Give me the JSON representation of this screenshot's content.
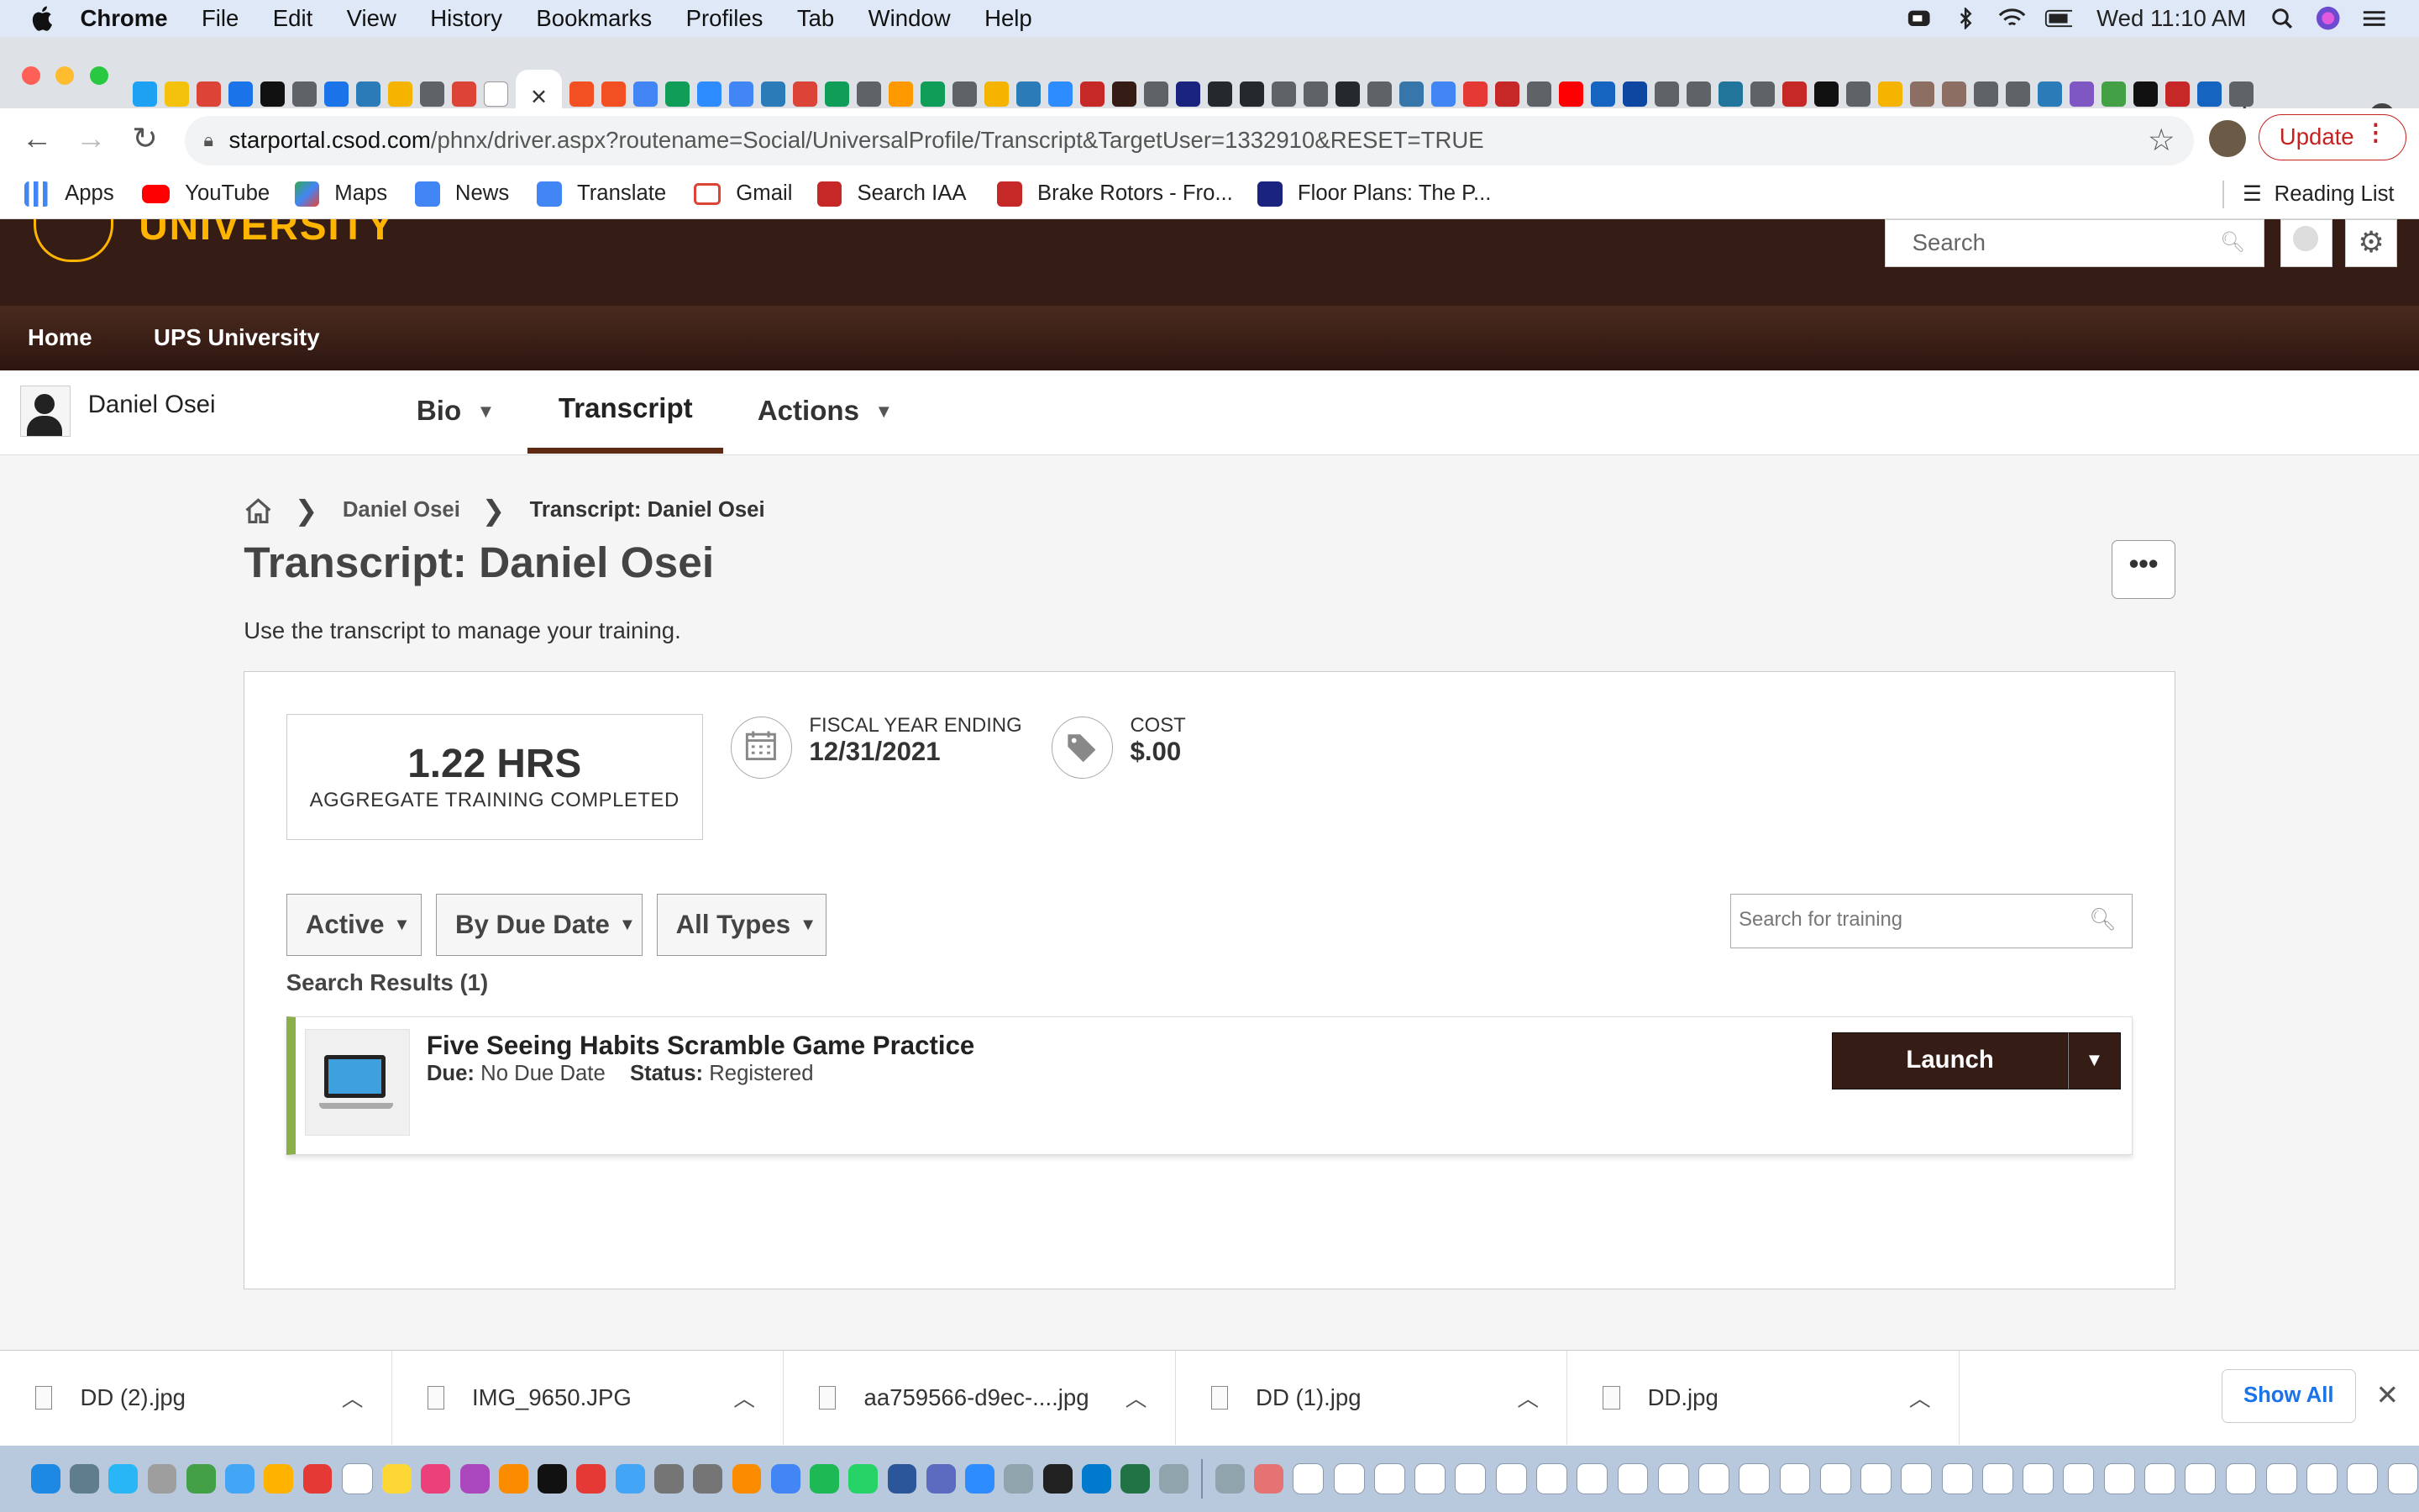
{
  "menubar": {
    "app": "Chrome",
    "items": [
      "File",
      "Edit",
      "View",
      "History",
      "Bookmarks",
      "Profiles",
      "Tab",
      "Window",
      "Help"
    ],
    "clock": "Wed 11:10 AM"
  },
  "tabs": {
    "favicon_colors": [
      "#1da1f2",
      "#f4c20d",
      "#db4437",
      "#1a73e8",
      "#111111",
      "#5f6368",
      "#1a73e8",
      "#2b7bb9",
      "#f4b400",
      "#5f6368",
      "#db4437",
      "#ffffff",
      "#f25022",
      "#f25022",
      "#4285f4",
      "#0f9d58",
      "#2d8cff",
      "#4285f4",
      "#2b7bb9",
      "#db4437",
      "#0f9d58",
      "#5f6368",
      "#ff9900",
      "#0f9d58",
      "#5f6368",
      "#f4b400",
      "#2b7bb9",
      "#2d8cff",
      "#c62828",
      "#351c15",
      "#5f6368",
      "#1a237e",
      "#24292e",
      "#24292e",
      "#5f6368",
      "#5f6368",
      "#24292e",
      "#5f6368",
      "#3776ab",
      "#4285f4",
      "#e53935",
      "#c62828",
      "#5f6368",
      "#ff0000",
      "#1565c0",
      "#0d47a1",
      "#5f6368",
      "#5f6368",
      "#21759b",
      "#5f6368",
      "#c62828",
      "#111111",
      "#5f6368",
      "#f4b400",
      "#8d6e63",
      "#8d6e63",
      "#5f6368",
      "#5f6368",
      "#2b7bb9",
      "#7e57c2",
      "#43a047",
      "#111111",
      "#c62828",
      "#1565c0",
      "#5f6368"
    ],
    "active_close": "×",
    "new_tab": "+"
  },
  "toolbar": {
    "url_host": "starportal.csod.com",
    "url_path": "/phnx/driver.aspx?routename=Social/UniversalProfile/Transcript&TargetUser=1332910&RESET=TRUE",
    "update_label": "Update"
  },
  "bookmarks": {
    "items": [
      {
        "label": "Apps",
        "color": "#4285f4"
      },
      {
        "label": "YouTube",
        "color": "#ff0000"
      },
      {
        "label": "Maps",
        "color": "#34a853"
      },
      {
        "label": "News",
        "color": "#4285f4"
      },
      {
        "label": "Translate",
        "color": "#4285f4"
      },
      {
        "label": "Gmail",
        "color": "#db4437"
      },
      {
        "label": "Search IAA",
        "color": "#c62828"
      },
      {
        "label": "Brake Rotors - Fro...",
        "color": "#c62828"
      },
      {
        "label": "Floor Plans: The P...",
        "color": "#1a237e"
      }
    ],
    "reading_list": "Reading List"
  },
  "site": {
    "brand_text": "UNIVERSITY",
    "search_placeholder": "Search",
    "nav": [
      "Home",
      "UPS University"
    ]
  },
  "profile": {
    "user_name": "Daniel Osei",
    "tabs": [
      {
        "label": "Bio",
        "has_caret": true
      },
      {
        "label": "Transcript",
        "active": true
      },
      {
        "label": "Actions",
        "has_caret": true
      }
    ]
  },
  "breadcrumb": {
    "link": "Daniel Osei",
    "current": "Transcript: Daniel Osei"
  },
  "page": {
    "title": "Transcript: Daniel Osei",
    "subtitle": "Use the transcript to manage your training.",
    "more_label": "•••"
  },
  "stats": {
    "hours_value": "1.22 HRS",
    "hours_label": "AGGREGATE TRAINING COMPLETED",
    "fy_label": "FISCAL YEAR ENDING",
    "fy_value": "12/31/2021",
    "cost_label": "COST",
    "cost_value": "$.00"
  },
  "filters": {
    "status": "Active",
    "sort": "By Due Date",
    "types": "All Types",
    "search_placeholder": "Search for training"
  },
  "results": {
    "label": "Search Results (1)",
    "items": [
      {
        "title": "Five Seeing Habits Scramble Game Practice",
        "due_label": "Due:",
        "due_value": "No Due Date",
        "status_label": "Status:",
        "status_value": "Registered",
        "action": "Launch"
      }
    ]
  },
  "downloads": {
    "items": [
      "DD (2).jpg",
      "IMG_9650.JPG",
      "aa759566-d9ec-....jpg",
      "DD (1).jpg",
      "DD.jpg"
    ],
    "show_all": "Show All"
  },
  "dock": {
    "icon_colors": [
      "#1e88e5",
      "#607d8b",
      "#29b6f6",
      "#9e9e9e",
      "#43a047",
      "#42a5f5",
      "#ffb300",
      "#e53935",
      "#ffffff",
      "#fdd835",
      "#ec407a",
      "#ab47bc",
      "#fb8c00",
      "#111111",
      "#e53935",
      "#42a5f5",
      "#757575",
      "#757575",
      "#fb8c00",
      "#4285f4",
      "#1db954",
      "#25d366",
      "#2b579a",
      "#5c6bc0",
      "#2d8cff",
      "#90a4ae",
      "#212121",
      "#007acc",
      "#217346",
      "#90a4ae",
      "#90a4ae",
      "#e57373",
      "#ffffff",
      "#ffffff",
      "#ffffff",
      "#ffffff",
      "#ffffff",
      "#ffffff",
      "#ffffff",
      "#ffffff",
      "#ffffff",
      "#ffffff",
      "#ffffff",
      "#ffffff",
      "#ffffff",
      "#ffffff",
      "#ffffff",
      "#ffffff",
      "#ffffff",
      "#ffffff",
      "#ffffff",
      "#ffffff",
      "#ffffff",
      "#ffffff",
      "#ffffff",
      "#ffffff",
      "#ffffff",
      "#ffffff",
      "#ffffff",
      "#ffffff",
      "#90a4ae"
    ]
  }
}
